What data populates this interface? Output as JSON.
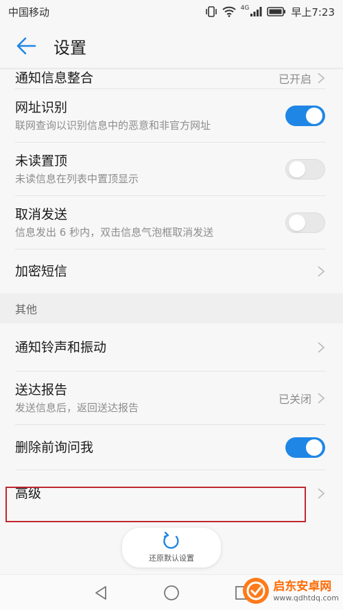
{
  "status": {
    "carrier": "中国移动",
    "network": "4G",
    "time": "早上7:23"
  },
  "header": {
    "title": "设置"
  },
  "items": [
    {
      "title": "通知信息整合",
      "value": "已开启"
    },
    {
      "title": "网址识别",
      "subtitle": "联网查询以识别信息中的恶意和非官方网址",
      "toggle": true
    },
    {
      "title": "未读置顶",
      "subtitle": "未读信息在列表中置顶显示",
      "toggle": false
    },
    {
      "title": "取消发送",
      "subtitle": "信息发出 6 秒内，双击信息气泡框取消发送",
      "toggle": false
    },
    {
      "title": "加密短信"
    }
  ],
  "section_other": {
    "label": "其他",
    "items": [
      {
        "title": "通知铃声和振动"
      },
      {
        "title": "送达报告",
        "subtitle": "发送信息后，返回送达报告",
        "value": "已关闭"
      },
      {
        "title": "删除前询问我",
        "toggle": true
      },
      {
        "title": "高级"
      }
    ]
  },
  "reset": {
    "label": "还原默认设置"
  },
  "watermark": {
    "name": "启东安卓网",
    "url": "www.qdhtdq.com"
  },
  "colors": {
    "accent": "#1f86e6",
    "highlight": "#c0262f"
  }
}
